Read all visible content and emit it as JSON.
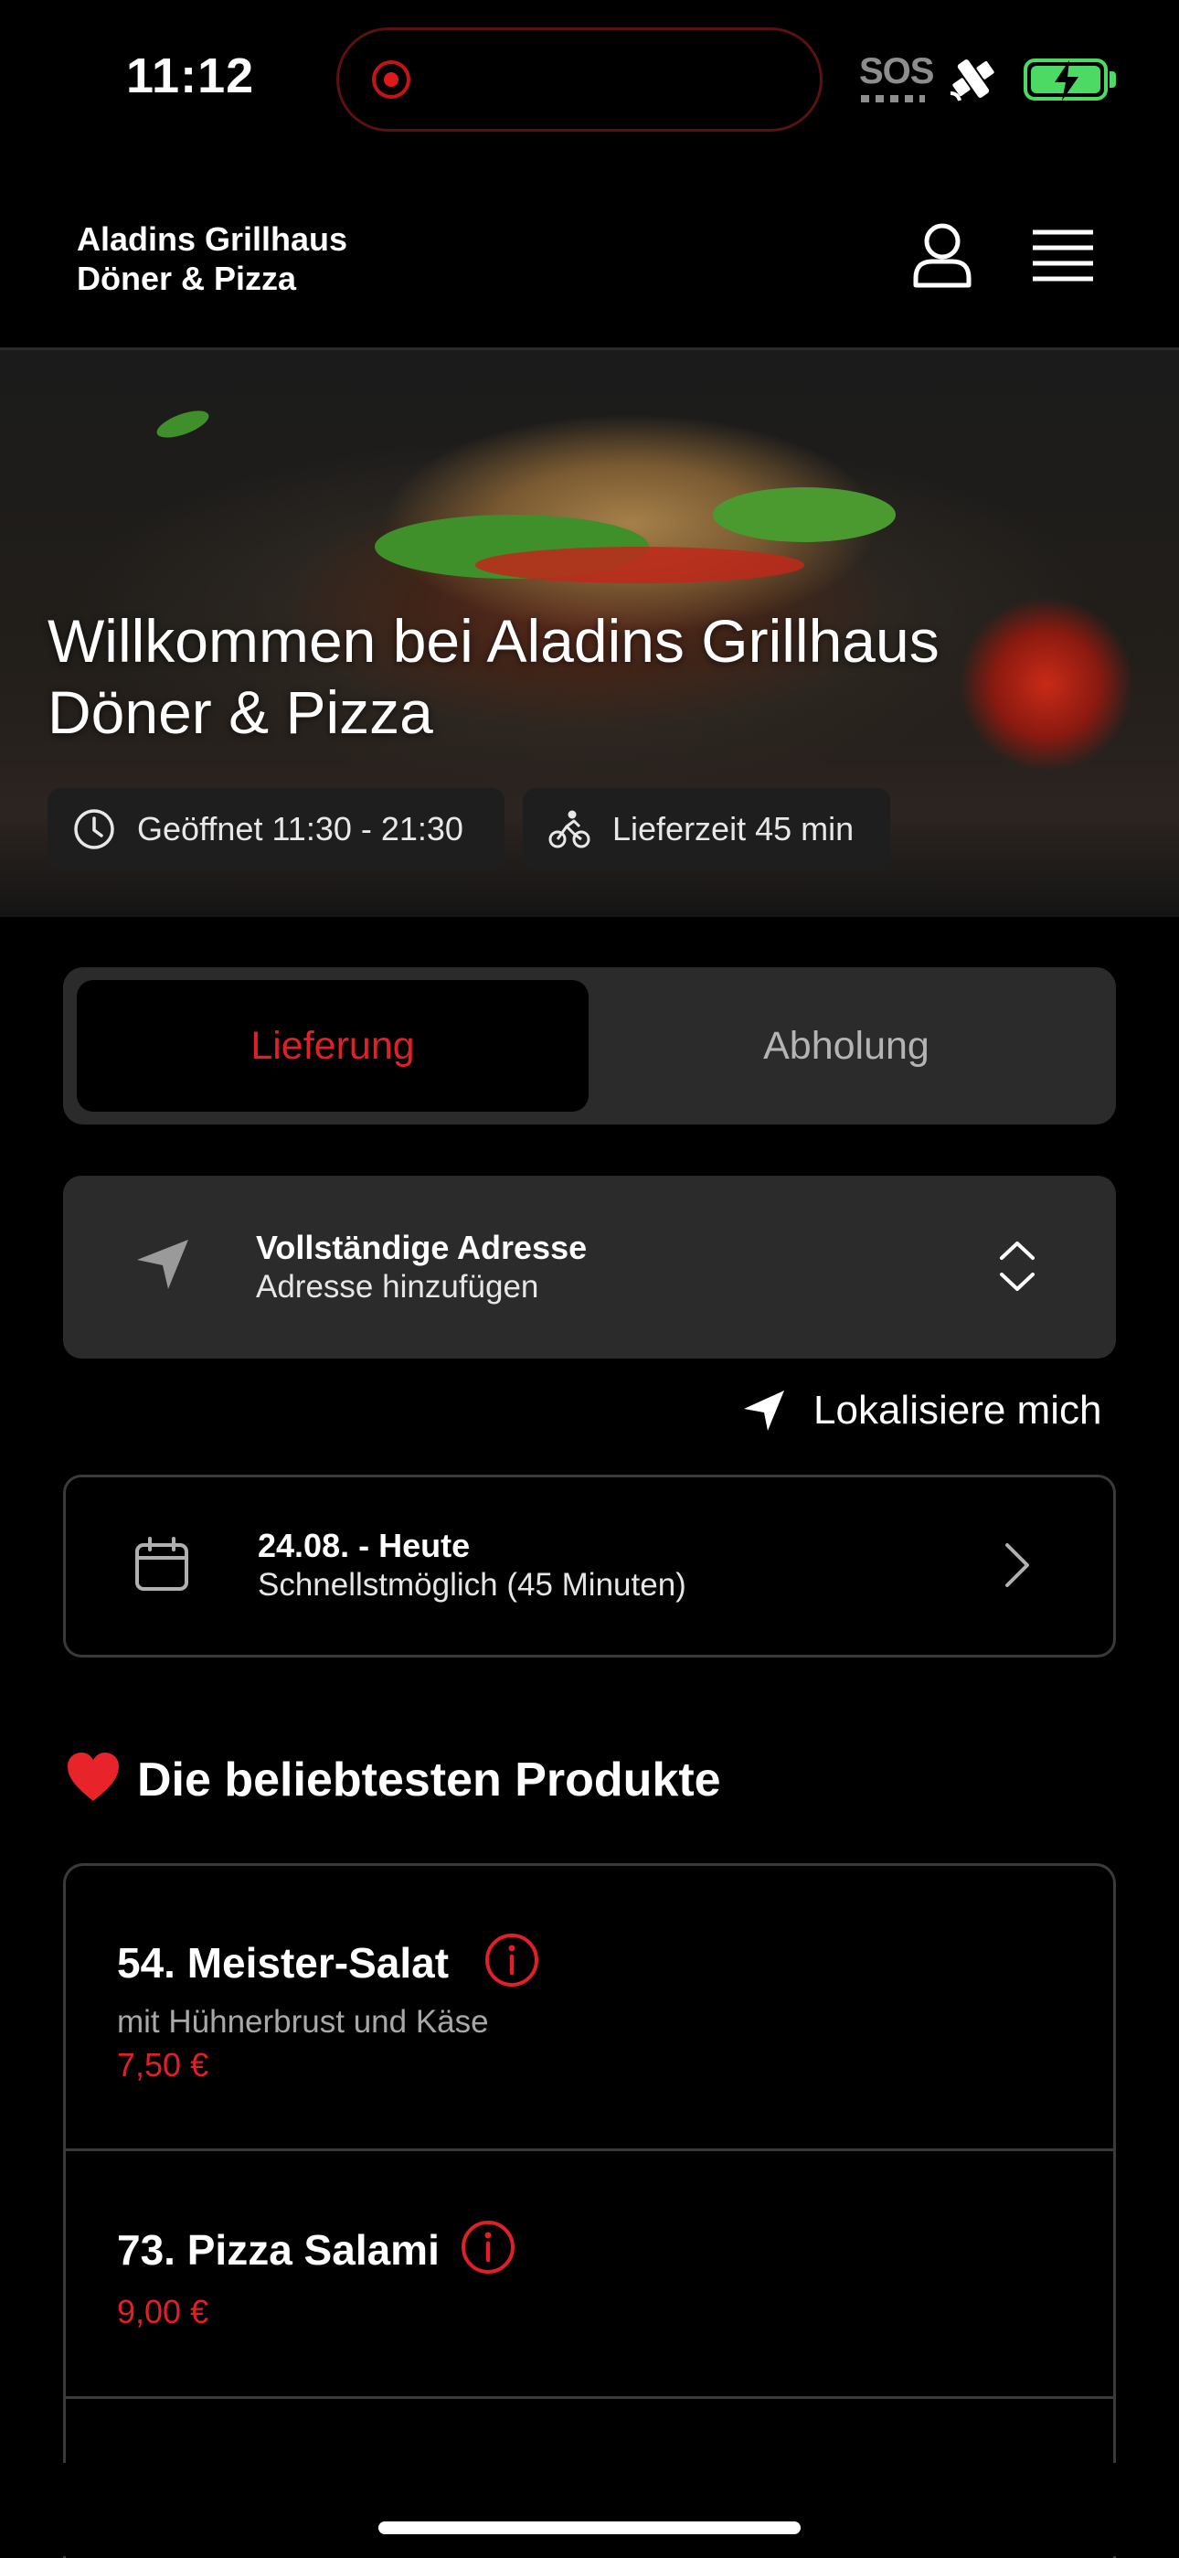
{
  "status_bar": {
    "time": "11:12",
    "sos": "SOS",
    "icons": [
      "record-icon",
      "satellite-icon",
      "battery-charging-icon"
    ]
  },
  "header": {
    "brand_line1": "Aladins Grillhaus",
    "brand_line2": "Döner & Pizza",
    "icons": [
      "user-icon",
      "menu-icon"
    ]
  },
  "hero": {
    "title_line1": "Willkommen bei Aladins Grillhaus",
    "title_line2": "Döner & Pizza",
    "opening_label": "Geöffnet 11:30 - 21:30",
    "delivery_time_label": "Lieferzeit 45 min"
  },
  "order_mode": {
    "options": [
      "Lieferung",
      "Abholung"
    ],
    "selected": "Lieferung",
    "accent": "#e01f26"
  },
  "address": {
    "title": "Vollständige Adresse",
    "subtitle": "Adresse hinzufügen",
    "locate_label": "Lokalisiere mich"
  },
  "schedule": {
    "date": "24.08. - Heute",
    "time": "Schnellstmöglich (45 Minuten)"
  },
  "popular": {
    "heading": "Die beliebtesten Produkte",
    "products": [
      {
        "name": "54. Meister-Salat",
        "description": "mit Hühnerbrust und Käse",
        "price": "7,50 €"
      },
      {
        "name": "73. Pizza Salami",
        "description": "",
        "price": "9,00 €"
      }
    ]
  }
}
